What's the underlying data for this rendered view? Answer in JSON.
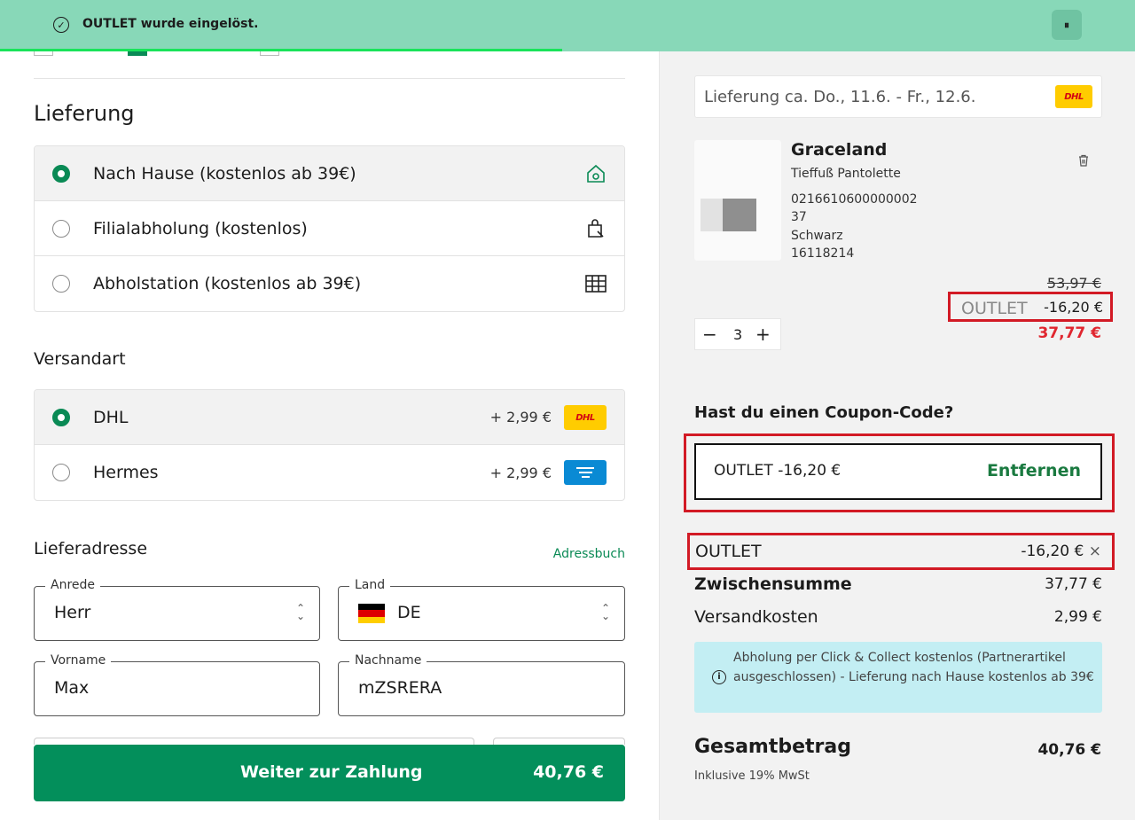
{
  "toast": {
    "message": "OUTLET wurde eingelöst.",
    "check_icon": "✓",
    "pause_icon": "⏸",
    "progress": 0.495,
    "progress_color": "#19e35a",
    "background": "#88d8b8"
  },
  "delivery_section": {
    "title": "Lieferung",
    "options": [
      {
        "label": "Nach Hause (kostenlos ab 39€)",
        "selected": true,
        "icon": "home-icon"
      },
      {
        "label": "Filialabholung (kostenlos)",
        "selected": false,
        "icon": "store-pickup-icon"
      },
      {
        "label": "Abholstation (kostenlos ab 39€)",
        "selected": false,
        "icon": "locker-icon"
      }
    ]
  },
  "shipping_section": {
    "title": "Versandart",
    "options": [
      {
        "label": "DHL",
        "price": "+ 2,99 €",
        "selected": true,
        "logo": "DHL"
      },
      {
        "label": "Hermes",
        "price": "+ 2,99 €",
        "selected": false,
        "logo": "hermes-logo"
      }
    ]
  },
  "address": {
    "title": "Lieferadresse",
    "addressbook_link": "Adressbuch",
    "salutation": {
      "label": "Anrede",
      "value": "Herr"
    },
    "country": {
      "label": "Land",
      "value": "DE"
    },
    "first_name": {
      "label": "Vorname",
      "value": "Max"
    },
    "last_name": {
      "label": "Nachname",
      "value": "mZSRERA"
    }
  },
  "pay_button": {
    "label": "Weiter zur Zahlung",
    "amount": "40,76 €"
  },
  "summary": {
    "delivery_estimate": "Lieferung ca. Do., 11.6. - Fr., 12.6.",
    "delivery_logo": "DHL",
    "product": {
      "name": "Graceland",
      "subtitle": "Tieffuß Pantolette",
      "article_no": "0216610600000002",
      "size": "37",
      "color": "Schwarz",
      "sku": "16118214",
      "old_price": "53,97 €",
      "coupon_code": "OUTLET",
      "coupon_amount": "-16,20 €",
      "new_price": "37,77 €",
      "quantity": "3",
      "minus": "−",
      "plus": "+"
    },
    "coupon_question": "Hast du einen Coupon-Code?",
    "applied_coupon": {
      "text": "OUTLET  -16,20 €",
      "remove_label": "Entfernen"
    },
    "discount_row": {
      "label": "OUTLET",
      "value": "-16,20 €",
      "close": "×"
    },
    "subtotal": {
      "label": "Zwischensumme",
      "value": "37,77 €"
    },
    "shipping_cost": {
      "label": "Versandkosten",
      "value": "2,99 €"
    },
    "info_text": "Abholung per Click & Collect kostenlos (Partnerartikel ausgeschlossen) - Lieferung nach Hause kostenlos ab 39€",
    "total": {
      "label": "Gesamtbetrag",
      "value": "40,76 €"
    },
    "vat_note": "Inklusive 19% MwSt"
  },
  "colors": {
    "accent_green": "#038f5b",
    "highlight_red": "#d21a25",
    "price_red": "#e0262f",
    "info_bg": "#c3eef3"
  }
}
